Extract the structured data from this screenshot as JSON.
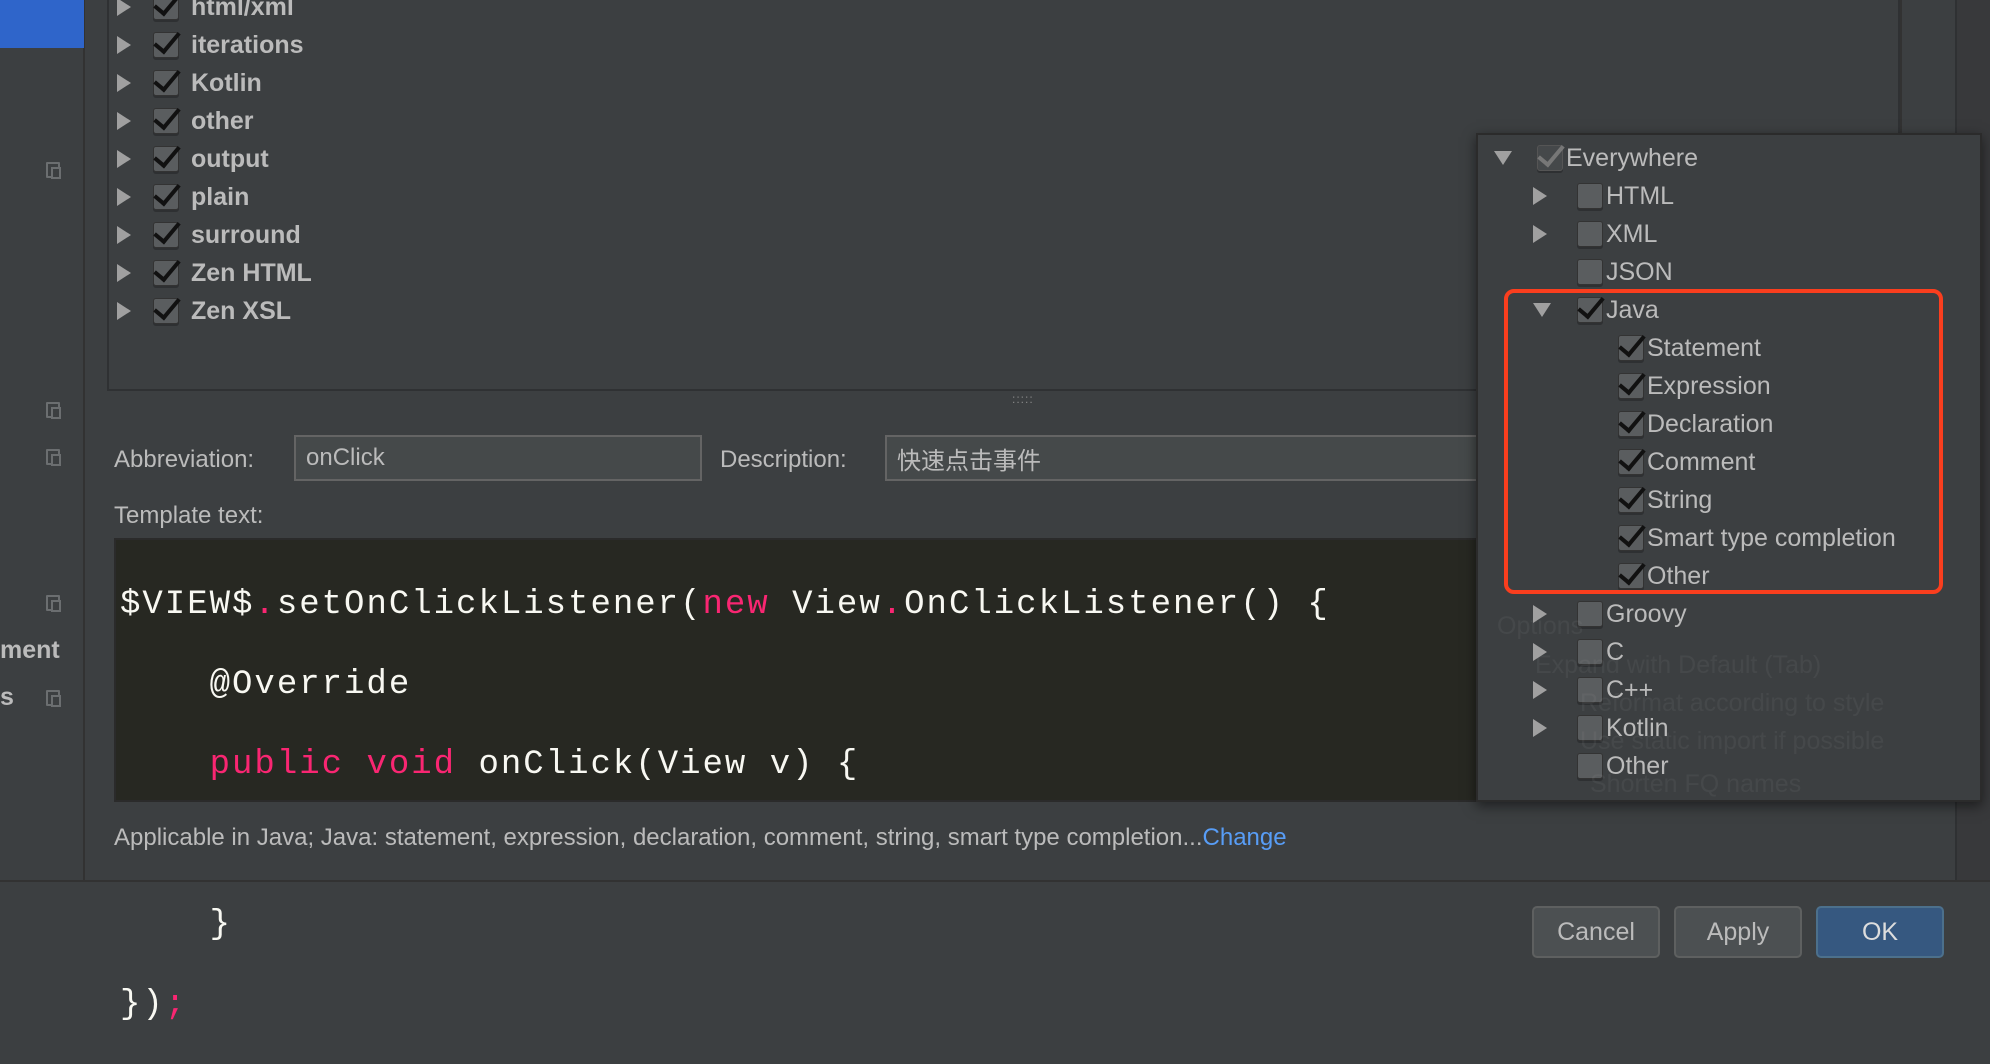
{
  "sidebar": {
    "partial_items": [
      "ment",
      "s"
    ]
  },
  "template_groups": [
    {
      "label": "html/xml",
      "checked": true
    },
    {
      "label": "iterations",
      "checked": true
    },
    {
      "label": "Kotlin",
      "checked": true
    },
    {
      "label": "other",
      "checked": true
    },
    {
      "label": "output",
      "checked": true
    },
    {
      "label": "plain",
      "checked": true
    },
    {
      "label": "surround",
      "checked": true
    },
    {
      "label": "Zen HTML",
      "checked": true
    },
    {
      "label": "Zen XSL",
      "checked": true
    }
  ],
  "splitter": ":::::",
  "form": {
    "abbreviation_label": "Abbreviation:",
    "abbreviation_value": "onClick",
    "description_label": "Description:",
    "description_value": "快速点击事件",
    "template_text_label": "Template text:"
  },
  "code": {
    "l1a": "$VIEW$",
    "l1b": ".",
    "l1c": "setOnClickListener(",
    "l1d": "new",
    "l1e": " View",
    "l1f": ".",
    "l1g": "OnClickListener() {",
    "l2": "    @Override",
    "l3a": "    ",
    "l3b": "public",
    "l3c": " ",
    "l3d": "void",
    "l3e": " onClick(View v) {",
    "l4": "",
    "l5": "    }",
    "l6a": "})",
    "l6b": ";"
  },
  "applicable": {
    "text": "Applicable in Java; Java: statement, expression, declaration, comment, string, smart type completion...",
    "link": "Change"
  },
  "buttons": {
    "cancel": "Cancel",
    "apply": "Apply",
    "ok": "OK"
  },
  "background_options": [
    "Options",
    "Expand with  Default (Tab)",
    "Reformat according to style",
    "Use static import if possible",
    "Shorten FQ names"
  ],
  "context_popup": {
    "root": {
      "label": "Everywhere",
      "checked": true,
      "expanded": true
    },
    "items": [
      {
        "label": "HTML",
        "checked": false,
        "expandable": true,
        "level": 1
      },
      {
        "label": "XML",
        "checked": false,
        "expandable": true,
        "level": 1
      },
      {
        "label": "JSON",
        "checked": false,
        "expandable": false,
        "level": 1
      },
      {
        "label": "Java",
        "checked": true,
        "expandable": true,
        "expanded": true,
        "level": 1
      },
      {
        "label": "Statement",
        "checked": true,
        "level": 2
      },
      {
        "label": "Expression",
        "checked": true,
        "level": 2
      },
      {
        "label": "Declaration",
        "checked": true,
        "level": 2
      },
      {
        "label": "Comment",
        "checked": true,
        "level": 2
      },
      {
        "label": "String",
        "checked": true,
        "level": 2
      },
      {
        "label": "Smart type completion",
        "checked": true,
        "level": 2
      },
      {
        "label": "Other",
        "checked": true,
        "level": 2
      },
      {
        "label": "Groovy",
        "checked": false,
        "expandable": true,
        "level": 1
      },
      {
        "label": "C",
        "checked": false,
        "expandable": true,
        "level": 1
      },
      {
        "label": "C++",
        "checked": false,
        "expandable": true,
        "level": 1
      },
      {
        "label": "Kotlin",
        "checked": false,
        "expandable": true,
        "level": 1
      },
      {
        "label": "Other",
        "checked": false,
        "expandable": false,
        "level": 1
      }
    ]
  },
  "colors": {
    "accent": "#2f65ca",
    "highlight_box": "#fa3e1e",
    "keyword": "#f92672",
    "link": "#589df6",
    "ok_button": "#365880"
  }
}
